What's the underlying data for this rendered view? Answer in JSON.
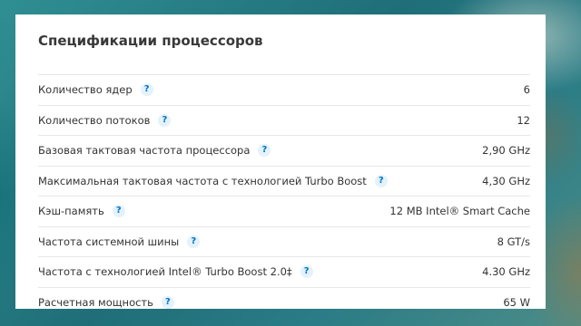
{
  "panel": {
    "title": "Спецификации процессоров",
    "help_icon": "question-mark-icon",
    "help_glyph": "?",
    "rows": [
      {
        "label": "Количество ядер",
        "value": "6"
      },
      {
        "label": "Количество потоков",
        "value": "12"
      },
      {
        "label": "Базовая тактовая частота процессора",
        "value": "2,90 GHz"
      },
      {
        "label": "Максимальная тактовая частота с технологией Turbo Boost",
        "value": "4,30 GHz"
      },
      {
        "label": "Кэш-память",
        "value": "12 MB Intel® Smart Cache"
      },
      {
        "label": "Частота системной шины",
        "value": "8 GT/s"
      },
      {
        "label": "Частота с технологией Intel® Turbo Boost 2.0‡",
        "value": "4.30 GHz"
      },
      {
        "label": "Расчетная мощность",
        "value": "65 W"
      }
    ]
  },
  "colors": {
    "accent": "#0071c5",
    "help_bg": "#e3f2fb",
    "text": "#333333"
  }
}
